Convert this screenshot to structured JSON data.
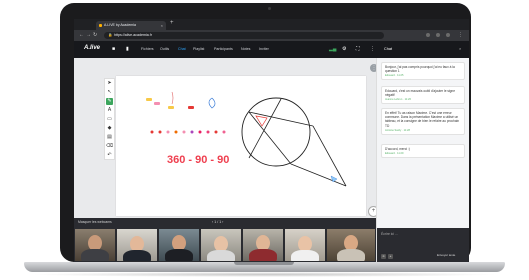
{
  "browser": {
    "tab_title": "A.LIVE by Academia",
    "tab_close": "×",
    "new_tab": "+",
    "url": "https://alive.academia.fr"
  },
  "app": {
    "logo": "A.live",
    "menu": [
      "Fichiers",
      "Outils",
      "Chat",
      "Playlist",
      "Participants",
      "Notes",
      "Inviter"
    ],
    "active_menu": "Chat",
    "chat_title": "Chat",
    "chat_close": "×"
  },
  "board": {
    "formula": "360 - 90 - 90",
    "more_glyph": "⋮",
    "zoom_in": "+",
    "zoom_out": "−"
  },
  "strip": {
    "mask_label": "Masquer les webcams",
    "pager": "‹  1 / 1  ›"
  },
  "chat": {
    "messages": [
      {
        "text": "Bonjour, j'ai pas compris pourquoi j'ai eu faux à la question 1",
        "meta": "Edouard · 11:25"
      },
      {
        "text": "Edouard, c'est un mauvais oubli d'ajouter le signe négatif",
        "meta": "Jeanne Lebrun · 11:26"
      },
      {
        "text": "En effet! Tu as raison Maxime. C'est une erreur commune. Dans la présentation Maxime a utilisé un tableau, et la consigne de bien le refaire au prochain TD",
        "meta": "Antoine Sardy · 11:28"
      },
      {
        "text": "D'accord, merci :)",
        "meta": "Edouard · 11:29"
      }
    ],
    "input_placeholder": "Écrire ici ...",
    "send_label": "Envoyer texte"
  },
  "colors": {
    "accent": "#2ea7ff",
    "formula": "#ef3f4f",
    "active_tool": "#3ba55c"
  }
}
